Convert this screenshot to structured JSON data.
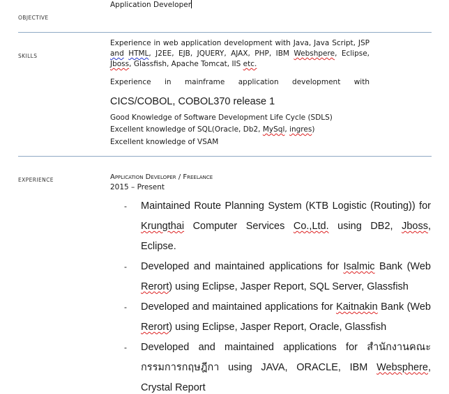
{
  "objective": {
    "label": "OBJECTIVE",
    "text": "Application Developer"
  },
  "skills": {
    "label": "SKILLS",
    "web": {
      "a": "Experience in web application development with Java, Java Script, JSP ",
      "and": "and",
      "html": "HTML",
      "b": ", J2EE, EJB, JQUERY, AJAX, PHP, IBM ",
      "websh": "Webshpere",
      "c": ", Eclipse, ",
      "jboss": "Jboss",
      "d": ", Glassfish, Apache Tomcat, IIS ",
      "etc": "etc."
    },
    "mainframe_small": "Experience in mainframe application development with ",
    "mainframe_big": "CICS/COBOL, COBOL370 release 1",
    "sdlc": "Good Knowledge of Software Development Life Cycle (SDLS)",
    "sql": {
      "a": "Excellent knowledge of SQL(Oracle, Db2, ",
      "mysql": "MySql",
      "b": ", ",
      "ingres": "ingres",
      "c": ")"
    },
    "vsam": "Excellent knowledge of VSAM"
  },
  "experience": {
    "label": "EXPERIENCE",
    "title": "Application Developer / Freelance",
    "dates": "2015 – Present",
    "bullet": "-",
    "items": [
      {
        "a": "Maintained Route Planning System (KTB Logistic (Routing)) for ",
        "s1": "Krungthai",
        "b": " Computer Services ",
        "s2": "Co.,Ltd.",
        "c": " using DB2, ",
        "s3": "Jboss",
        "d": ", Eclipse."
      },
      {
        "a": "Developed and maintained applications for ",
        "s1": "Isalmic",
        "b": " Bank (Web ",
        "s2": "Rerort",
        "c": ") using Eclipse, Jasper Report, SQL Server, Glassfish"
      },
      {
        "a": "Developed and maintained applications for ",
        "s1": "Kaitnakin",
        "b": " Bank (Web ",
        "s2": "Rerort",
        "c": ") using Eclipse, Jasper Report, Oracle, Glassfish"
      },
      {
        "a": "Developed and maintained applications for สำนักงานคณะกรรมการกฤษฎีกา using JAVA, ORACLE, IBM ",
        "s1": "Websphere",
        "b": ", Crystal Report"
      }
    ]
  }
}
